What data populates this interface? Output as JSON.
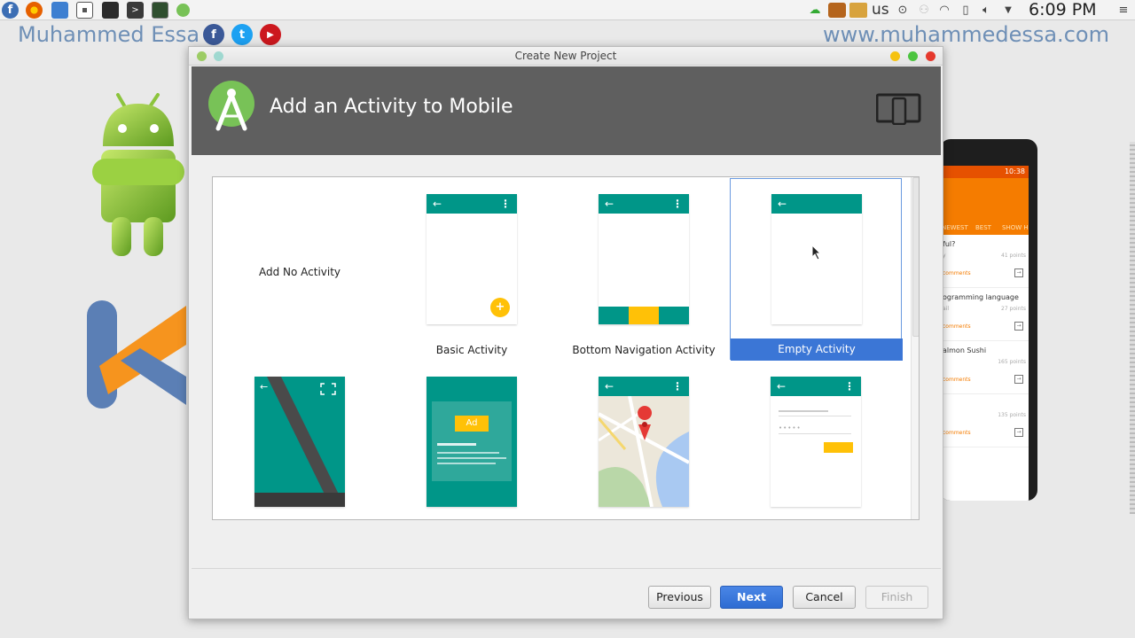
{
  "system_bar": {
    "launchers": [
      {
        "icon": "fedora-icon",
        "color": "#3c6eb4"
      },
      {
        "icon": "firefox-icon",
        "color": "#e66000"
      },
      {
        "icon": "files-icon",
        "color": "#3d7fd1"
      },
      {
        "icon": "screenshot-icon",
        "color": "#555555"
      },
      {
        "icon": "terminal-icon",
        "color": "#2b2b2b"
      },
      {
        "icon": "terminal-prompt-icon",
        "color": "#3a3a3a"
      },
      {
        "icon": "system-monitor-icon",
        "color": "#3b6e3b"
      },
      {
        "icon": "android-studio-icon",
        "color": "#78c257"
      }
    ],
    "keyboard_layout": "us",
    "clock": "6:09 PM"
  },
  "overlay": {
    "channel_name": "Muhammed Essa",
    "channel_url": "www.muhammedessa.com",
    "social": [
      {
        "icon": "facebook-icon",
        "glyph": "f",
        "color": "#3b5998"
      },
      {
        "icon": "twitter-icon",
        "glyph": "t",
        "color": "#1da1f2"
      },
      {
        "icon": "youtube-icon",
        "glyph": "▶",
        "color": "#cc181e"
      }
    ]
  },
  "phone": {
    "status_time": "10:38",
    "tabs": [
      "NEWEST",
      "BEST",
      "SHOW H"
    ],
    "items": [
      {
        "title": "ful?",
        "sub": "y",
        "points": "41 points",
        "link": "comments"
      },
      {
        "title": "ogramming language",
        "sub": "ail",
        "points": "27 points",
        "link": "comments"
      },
      {
        "title": "almon Sushi",
        "sub": "",
        "points": "165 points",
        "link": "comments"
      },
      {
        "title": "",
        "sub": "",
        "points": "135 points",
        "link": "comments"
      }
    ]
  },
  "dialog": {
    "window_title": "Create New Project",
    "header_title": "Add an Activity to Mobile",
    "tiles": [
      {
        "label": "Add No Activity",
        "selected": false
      },
      {
        "label": "Basic Activity",
        "selected": false
      },
      {
        "label": "Bottom Navigation Activity",
        "selected": false
      },
      {
        "label": "Empty Activity",
        "selected": true
      },
      {
        "label": "",
        "selected": false
      },
      {
        "label": "",
        "selected": false
      },
      {
        "label": "",
        "selected": false
      },
      {
        "label": "",
        "selected": false
      }
    ],
    "ad_badge": "Ad",
    "buttons": {
      "previous": "Previous",
      "next": "Next",
      "cancel": "Cancel",
      "finish": "Finish"
    },
    "accent_colors": {
      "teal": "#009688",
      "amber": "#ffc107",
      "selection": "#3b76d6"
    }
  }
}
